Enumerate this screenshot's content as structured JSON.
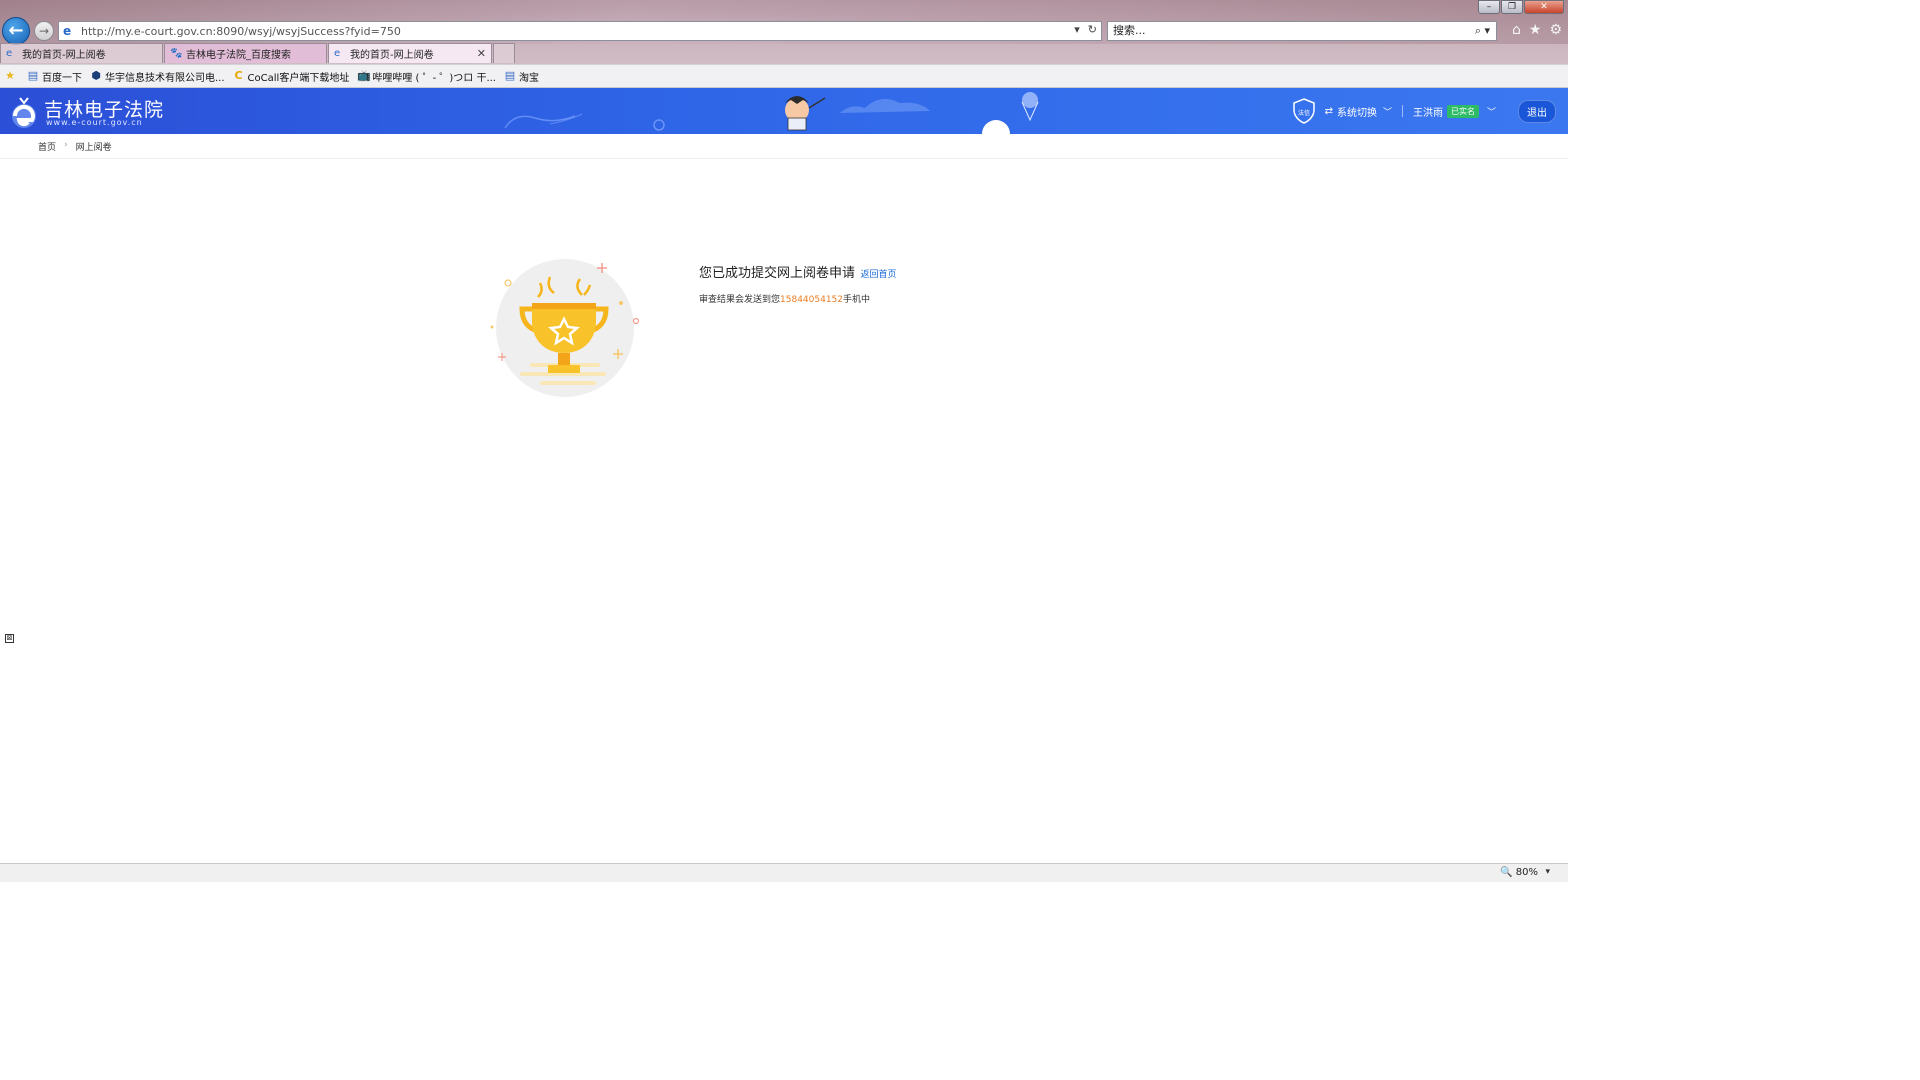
{
  "browser": {
    "url": "http://my.e-court.gov.cn:8090/wsyj/wsyjSuccess?fyid=750",
    "search_placeholder": "搜索...",
    "tabs": [
      {
        "label": "我的首页-网上阅卷"
      },
      {
        "label": "吉林电子法院_百度搜索"
      },
      {
        "label": "我的首页-网上阅卷"
      }
    ],
    "favorites": [
      {
        "label": "百度一下"
      },
      {
        "label": "华宇信息技术有限公司电..."
      },
      {
        "label": "CoCall客户端下载地址"
      },
      {
        "label": "哔哩哔哩 ( ゜- ゜)つロ 干..."
      },
      {
        "label": "淘宝"
      }
    ],
    "zoom": "80%"
  },
  "header": {
    "site_title": "吉林电子法院",
    "site_url": "www.e-court.gov.cn",
    "badge_text": "法信",
    "system_switch": "系统切换",
    "user_name": "王洪雨",
    "verified": "已实名",
    "logout": "退出"
  },
  "breadcrumb": {
    "home": "首页",
    "current": "网上阅卷"
  },
  "result": {
    "message": "您已成功提交网上阅卷申请",
    "back_link": "返回首页",
    "sub_prefix": "审查结果会发送到您",
    "phone": "15844054152",
    "sub_suffix": "手机中"
  },
  "colors": {
    "header_blue": "#2f66e8",
    "link_blue": "#1b6ad6",
    "phone_orange": "#ee7d23",
    "verified_green": "#2dbb66",
    "trophy_gold": "#f5b51b"
  }
}
